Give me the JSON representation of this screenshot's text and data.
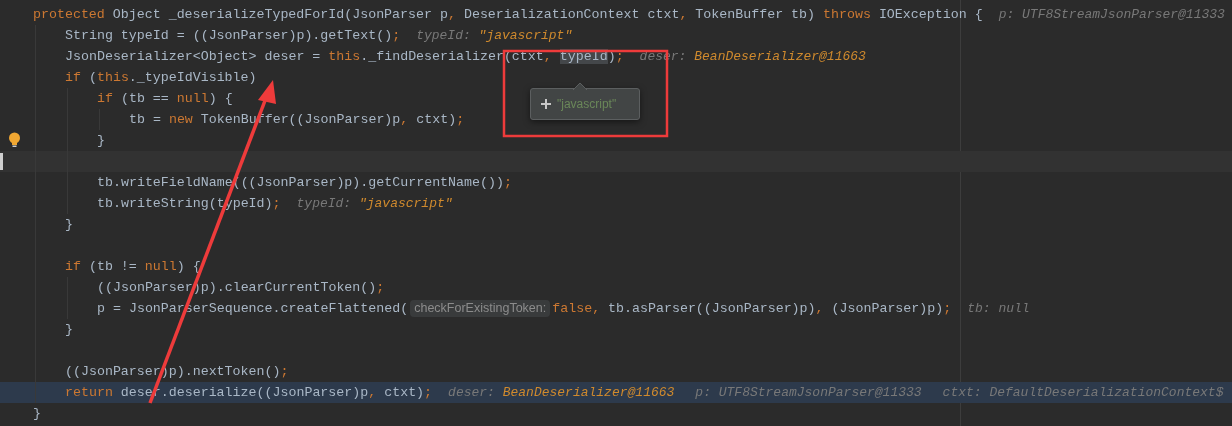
{
  "editor": {
    "lines": [
      {
        "caret_line": false,
        "execution_point": false,
        "intention_bulb": false,
        "tokens": [
          {
            "kind": "keyword",
            "text": "protected"
          },
          {
            "kind": "plain",
            "text": " Object _deserializeTypedForId(JsonParser p"
          },
          {
            "kind": "punct",
            "text": ","
          },
          {
            "kind": "plain",
            "text": " DeserializationContext ctxt"
          },
          {
            "kind": "punct",
            "text": ","
          },
          {
            "kind": "plain",
            "text": " TokenBuffer tb) "
          },
          {
            "kind": "keyword",
            "text": "throws"
          },
          {
            "kind": "plain",
            "text": " IOException {"
          }
        ],
        "hints": [
          {
            "name": "p:",
            "value": "UTF8StreamJsonParser@11333",
            "highlighted": false
          }
        ],
        "children": [
          {
            "caret_line": false,
            "execution_point": false,
            "intention_bulb": false,
            "tokens": [
              {
                "kind": "plain",
                "text": "String typeId = ((JsonParser)p).getText()"
              },
              {
                "kind": "punct",
                "text": ";"
              }
            ],
            "hints": [
              {
                "name": "typeId:",
                "value": "\"javascript\"",
                "highlighted": true
              }
            ]
          },
          {
            "caret_line": false,
            "execution_point": false,
            "intention_bulb": false,
            "tokens": [
              {
                "kind": "plain",
                "text": "JsonDeserializer<Object> deser = "
              },
              {
                "kind": "keyword",
                "text": "this"
              },
              {
                "kind": "plain",
                "text": "._findDeserializer(ctxt"
              },
              {
                "kind": "punct",
                "text": ", "
              },
              {
                "kind": "selected",
                "text": "typeId"
              },
              {
                "kind": "plain",
                "text": ")"
              },
              {
                "kind": "punct",
                "text": ";"
              }
            ],
            "hints": [
              {
                "name": "deser:",
                "value": "BeanDeserializer@11663",
                "highlighted": true
              }
            ]
          },
          {
            "caret_line": false,
            "execution_point": false,
            "intention_bulb": false,
            "tokens": [
              {
                "kind": "keyword",
                "text": "if"
              },
              {
                "kind": "plain",
                "text": " ("
              },
              {
                "kind": "keyword",
                "text": "this"
              },
              {
                "kind": "plain",
                "text": "._typeIdVisible)"
              }
            ],
            "children": [
              {
                "caret_line": false,
                "execution_point": false,
                "intention_bulb": false,
                "tokens": [
                  {
                    "kind": "keyword",
                    "text": "if"
                  },
                  {
                    "kind": "plain",
                    "text": " (tb == "
                  },
                  {
                    "kind": "keyword",
                    "text": "null"
                  },
                  {
                    "kind": "plain",
                    "text": ") {"
                  }
                ],
                "children": [
                  {
                    "caret_line": false,
                    "execution_point": false,
                    "intention_bulb": false,
                    "tokens": [
                      {
                        "kind": "plain",
                        "text": "tb = "
                      },
                      {
                        "kind": "keyword",
                        "text": "new"
                      },
                      {
                        "kind": "plain",
                        "text": " TokenBuffer((JsonParser)p"
                      },
                      {
                        "kind": "punct",
                        "text": ","
                      },
                      {
                        "kind": "plain",
                        "text": " ctxt)"
                      },
                      {
                        "kind": "punct",
                        "text": ";"
                      }
                    ]
                  }
                ]
              },
              {
                "caret_line": false,
                "execution_point": false,
                "intention_bulb": true,
                "tokens": [
                  {
                    "kind": "plain",
                    "text": "}"
                  }
                ]
              },
              {
                "caret_line": true,
                "execution_point": false,
                "intention_bulb": false
              },
              {
                "caret_line": false,
                "execution_point": false,
                "intention_bulb": false,
                "tokens": [
                  {
                    "kind": "plain",
                    "text": "tb.writeFieldName(((JsonParser)p).getCurrentName())"
                  },
                  {
                    "kind": "punct",
                    "text": ";"
                  }
                ]
              },
              {
                "caret_line": false,
                "execution_point": false,
                "intention_bulb": false,
                "tokens": [
                  {
                    "kind": "plain",
                    "text": "tb.writeString(typeId)"
                  },
                  {
                    "kind": "punct",
                    "text": ";"
                  }
                ],
                "hints": [
                  {
                    "name": "typeId:",
                    "value": "\"javascript\"",
                    "highlighted": true
                  }
                ]
              }
            ]
          },
          {
            "caret_line": false,
            "execution_point": false,
            "intention_bulb": false,
            "tokens": [
              {
                "kind": "plain",
                "text": "}"
              }
            ]
          },
          {
            "caret_line": false,
            "execution_point": false,
            "intention_bulb": false
          },
          {
            "caret_line": false,
            "execution_point": false,
            "intention_bulb": false,
            "tokens": [
              {
                "kind": "keyword",
                "text": "if"
              },
              {
                "kind": "plain",
                "text": " (tb != "
              },
              {
                "kind": "keyword",
                "text": "null"
              },
              {
                "kind": "plain",
                "text": ") {"
              }
            ],
            "children": [
              {
                "caret_line": false,
                "execution_point": false,
                "intention_bulb": false,
                "tokens": [
                  {
                    "kind": "plain",
                    "text": "((JsonParser)p).clearCurrentToken()"
                  },
                  {
                    "kind": "punct",
                    "text": ";"
                  }
                ]
              },
              {
                "caret_line": false,
                "execution_point": false,
                "intention_bulb": false,
                "tokens": [
                  {
                    "kind": "plain",
                    "text": "p = JsonParserSequence.createFlattened("
                  },
                  {
                    "kind": "param_hint",
                    "text": "checkForExistingToken:"
                  },
                  {
                    "kind": "keyword",
                    "text": "false"
                  },
                  {
                    "kind": "punct",
                    "text": ","
                  },
                  {
                    "kind": "plain",
                    "text": " tb.asParser((JsonParser)p)"
                  },
                  {
                    "kind": "punct",
                    "text": ","
                  },
                  {
                    "kind": "plain",
                    "text": " (JsonParser)p)"
                  },
                  {
                    "kind": "punct",
                    "text": ";"
                  }
                ],
                "hints": [
                  {
                    "name": "tb:",
                    "value": "null",
                    "highlighted": false
                  }
                ]
              }
            ]
          },
          {
            "caret_line": false,
            "execution_point": false,
            "intention_bulb": false,
            "tokens": [
              {
                "kind": "plain",
                "text": "}"
              }
            ]
          },
          {
            "caret_line": false,
            "execution_point": false,
            "intention_bulb": false
          },
          {
            "caret_line": false,
            "execution_point": false,
            "intention_bulb": false,
            "tokens": [
              {
                "kind": "plain",
                "text": "((JsonParser)p).nextToken()"
              },
              {
                "kind": "punct",
                "text": ";"
              }
            ]
          },
          {
            "caret_line": false,
            "execution_point": true,
            "intention_bulb": false,
            "tokens": [
              {
                "kind": "keyword",
                "text": "return"
              },
              {
                "kind": "plain",
                "text": " deser.deserialize((JsonParser)p"
              },
              {
                "kind": "punct",
                "text": ","
              },
              {
                "kind": "plain",
                "text": " ctxt)"
              },
              {
                "kind": "punct",
                "text": ";"
              }
            ],
            "hints": [
              {
                "name": "deser:",
                "value": "BeanDeserializer@11663",
                "highlighted": true
              },
              {
                "name": "p:",
                "value": "UTF8StreamJsonParser@11333",
                "highlighted": false
              },
              {
                "name": "ctxt:",
                "value": "DefaultDeserializationContext$",
                "highlighted": false
              }
            ]
          }
        ]
      },
      {
        "caret_line": false,
        "execution_point": false,
        "intention_bulb": false,
        "tokens": [
          {
            "kind": "plain",
            "text": "}"
          }
        ]
      }
    ]
  },
  "tooltip": {
    "value": "\"javascript\""
  }
}
